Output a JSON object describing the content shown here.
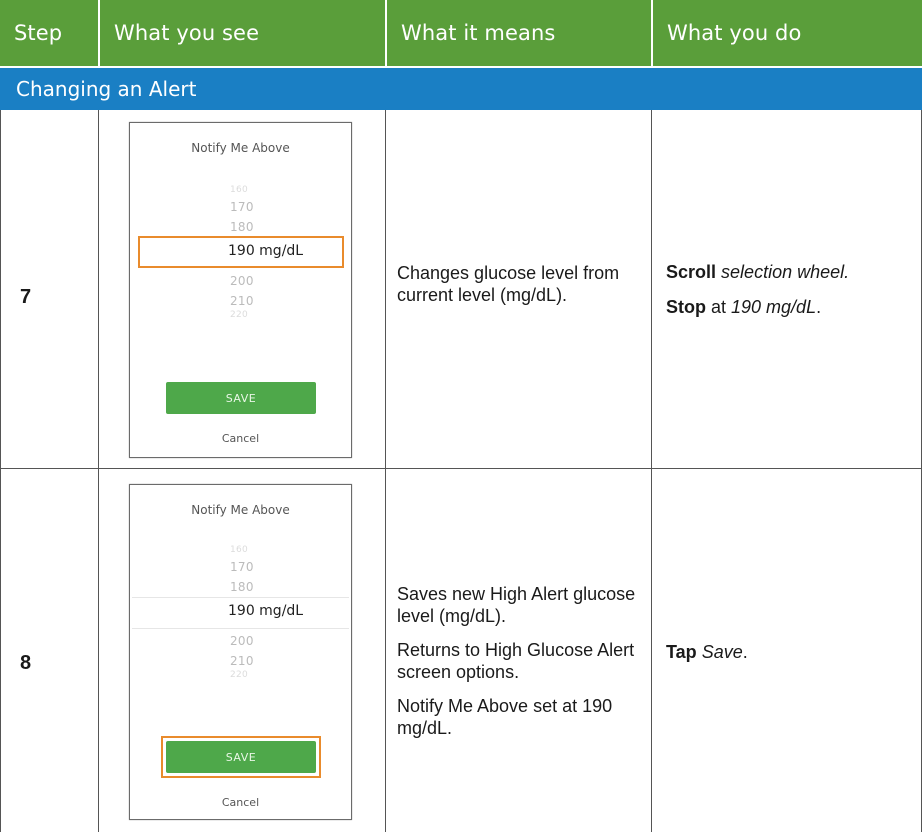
{
  "header": {
    "col_step": "Step",
    "col_see": "What you see",
    "col_means": "What it means",
    "col_do": "What you do"
  },
  "section_title": "Changing an Alert",
  "colors": {
    "header_green": "#5a9e3a",
    "section_blue": "#1a7fc4",
    "highlight_orange": "#e98b2c",
    "save_green": "#4ea84a"
  },
  "rows": [
    {
      "step": "7",
      "screen": {
        "title": "Notify Me Above",
        "wheel_above": [
          "160",
          "170",
          "180"
        ],
        "selected": "190 mg/dL",
        "wheel_below": [
          "200",
          "210",
          "220"
        ],
        "save_label": "SAVE",
        "cancel_label": "Cancel",
        "highlight": "selection-wheel"
      },
      "meaning": [
        "Changes glucose level from current level (mg/dL)."
      ],
      "todo": [
        {
          "bold": "Scroll",
          "italic": "selection wheel.",
          "plain": ""
        },
        {
          "bold": "Stop",
          "plain_before": " at ",
          "italic": "190 mg/dL",
          "plain": "."
        }
      ]
    },
    {
      "step": "8",
      "screen": {
        "title": "Notify Me Above",
        "wheel_above": [
          "160",
          "170",
          "180"
        ],
        "selected": "190 mg/dL",
        "wheel_below": [
          "200",
          "210",
          "220"
        ],
        "save_label": "SAVE",
        "cancel_label": "Cancel",
        "highlight": "save-button"
      },
      "meaning": [
        "Saves new High Alert glucose level (mg/dL).",
        "Returns to High Glucose Alert screen options.",
        "Notify Me Above set at 190 mg/dL."
      ],
      "todo": [
        {
          "bold": "Tap",
          "italic": "Save",
          "plain": "."
        }
      ]
    }
  ]
}
